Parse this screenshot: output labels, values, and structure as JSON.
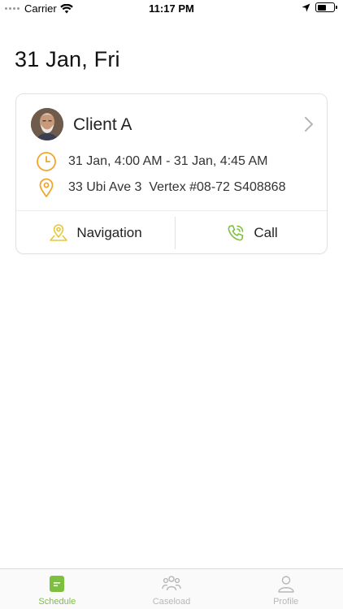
{
  "status_bar": {
    "carrier": "Carrier",
    "time": "11:17 PM"
  },
  "page": {
    "date_title": "31 Jan, Fri"
  },
  "appointment": {
    "client_name": "Client A",
    "time_range": "31 Jan, 4:00 AM - 31 Jan, 4:45 AM",
    "address": "33 Ubi Ave 3  Vertex #08-72 S408868",
    "navigation_label": "Navigation",
    "call_label": "Call"
  },
  "tab_bar": {
    "tabs": [
      {
        "label": "Schedule",
        "icon": "schedule-icon",
        "active": true
      },
      {
        "label": "Caseload",
        "icon": "people-icon",
        "active": false
      },
      {
        "label": "Profile",
        "icon": "user-icon",
        "active": false
      }
    ]
  },
  "colors": {
    "accent_orange": "#f0a62b",
    "accent_green": "#7dbf3f",
    "nav_icon_yellow": "#e7c63a",
    "tab_inactive": "#b7b7b7"
  }
}
